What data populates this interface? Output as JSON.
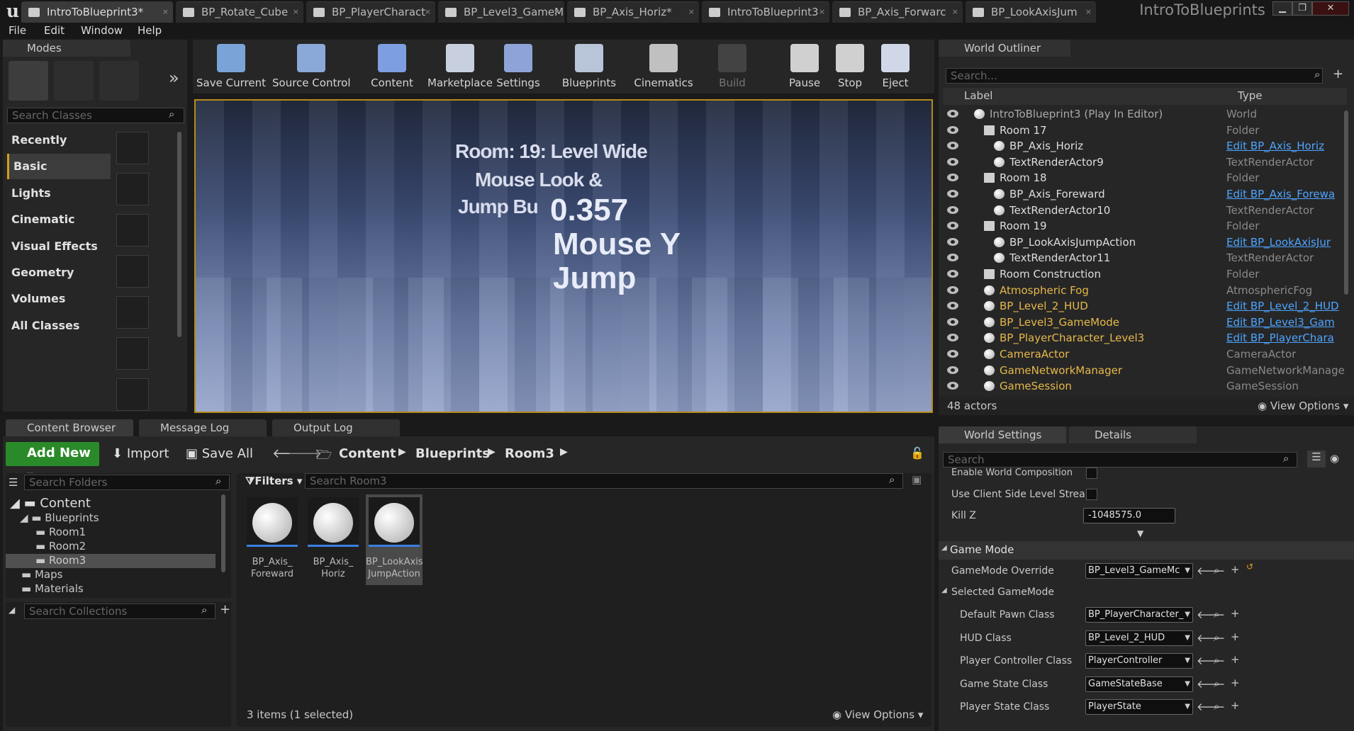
{
  "window": {
    "project_name": "IntroToBlueprints"
  },
  "doc_tabs": [
    "IntroToBlueprint3*",
    "BP_Rotate_Cube",
    "BP_PlayerCharact",
    "BP_Level3_GameM",
    "BP_Axis_Horiz*",
    "IntroToBlueprint3",
    "BP_Axis_Forwarc",
    "BP_LookAxisJum"
  ],
  "menu": [
    "File",
    "Edit",
    "Window",
    "Help"
  ],
  "modes": {
    "title": "Modes",
    "search_placeholder": "Search Classes",
    "categories": [
      "Recently Placed",
      "Basic",
      "Lights",
      "Cinematic",
      "Visual Effects",
      "Geometry",
      "Volumes",
      "All Classes"
    ]
  },
  "toolbar": [
    "Save Current",
    "Source Control",
    "Content",
    "Marketplace",
    "Settings",
    "Blueprints",
    "Cinematics",
    "Build",
    "Pause",
    "Stop",
    "Eject"
  ],
  "viewport": {
    "text1": "Room: 19: Level Wide",
    "text2": "Mouse Look &",
    "text3": "Jump Bu",
    "value": "0.357",
    "axis": "Mouse Y",
    "action": "Jump"
  },
  "outliner": {
    "title": "World Outliner",
    "search_placeholder": "Search...",
    "col_label": "Label",
    "col_type": "Type",
    "rows": [
      {
        "label": "IntroToBlueprint3 (Play In Editor)",
        "type": "World"
      },
      {
        "label": "Room 17",
        "type": "Folder"
      },
      {
        "label": "BP_Axis_Horiz",
        "type": "Edit BP_Axis_Horiz"
      },
      {
        "label": "TextRenderActor9",
        "type": "TextRenderActor"
      },
      {
        "label": "Room 18",
        "type": "Folder"
      },
      {
        "label": "BP_Axis_Foreward",
        "type": "Edit BP_Axis_Forewa"
      },
      {
        "label": "TextRenderActor10",
        "type": "TextRenderActor"
      },
      {
        "label": "Room 19",
        "type": "Folder"
      },
      {
        "label": "BP_LookAxisJumpAction",
        "type": "Edit BP_LookAxisJur"
      },
      {
        "label": "TextRenderActor11",
        "type": "TextRenderActor"
      },
      {
        "label": "Room Construction",
        "type": "Folder"
      },
      {
        "label": "Atmospheric Fog",
        "type": "AtmosphericFog"
      },
      {
        "label": "BP_Level_2_HUD",
        "type": "Edit BP_Level_2_HUD"
      },
      {
        "label": "BP_Level3_GameMode",
        "type": "Edit BP_Level3_Gam"
      },
      {
        "label": "BP_PlayerCharacter_Level3",
        "type": "Edit BP_PlayerChara"
      },
      {
        "label": "CameraActor",
        "type": "CameraActor"
      },
      {
        "label": "GameNetworkManager",
        "type": "GameNetworkManage"
      },
      {
        "label": "GameSession",
        "type": "GameSession"
      }
    ],
    "actor_count": "48 actors",
    "view_options": "View Options"
  },
  "bottom_tabs": [
    "Content Browser",
    "Message Log",
    "Output Log"
  ],
  "content_browser": {
    "add_new": "Add New",
    "import": "Import",
    "save_all": "Save All",
    "path": [
      "Content",
      "Blueprints",
      "Room3"
    ],
    "folder_search": "Search Folders",
    "filters": "Filters",
    "asset_search": "Search Room3",
    "tree": [
      "Content",
      "Blueprints",
      "Room1",
      "Room2",
      "Room3",
      "Maps",
      "Materials"
    ],
    "collections_search": "Search Collections",
    "assets": [
      {
        "line1": "BP_Axis_",
        "line2": "Foreward"
      },
      {
        "line1": "BP_Axis_",
        "line2": "Horiz"
      },
      {
        "line1": "BP_LookAxis",
        "line2": "JumpAction"
      }
    ],
    "status": "3 items (1 selected)",
    "view_options": "View Options"
  },
  "details": {
    "tab1": "World Settings",
    "tab2": "Details",
    "search_placeholder": "Search",
    "enable_world_comp": "Enable World Composition",
    "use_client_side": "Use Client Side Level Strea",
    "kill_z_label": "Kill Z",
    "kill_z_value": "-1048575.0",
    "game_mode_section": "Game Mode",
    "gamemode_override": "GameMode Override",
    "gamemode_value": "BP_Level3_GameMc",
    "selected_gamemode": "Selected GameMode",
    "props": [
      {
        "label": "Default Pawn Class",
        "value": "BP_PlayerCharacter_"
      },
      {
        "label": "HUD Class",
        "value": "BP_Level_2_HUD"
      },
      {
        "label": "Player Controller Class",
        "value": "PlayerController"
      },
      {
        "label": "Game State Class",
        "value": "GameStateBase"
      },
      {
        "label": "Player State Class",
        "value": "PlayerState"
      }
    ]
  }
}
